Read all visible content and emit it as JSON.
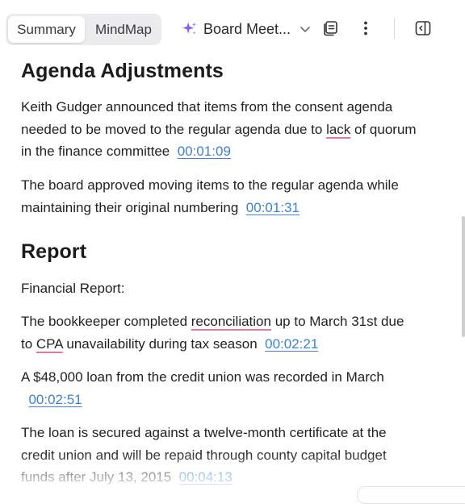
{
  "toolbar": {
    "tabs": [
      {
        "label": "Summary",
        "active": true
      },
      {
        "label": "MindMap",
        "active": false
      }
    ],
    "document_title": "Board Meet...",
    "icons": [
      "sparkle-icon",
      "chevron-down-icon",
      "notes-icon",
      "more-vertical-icon",
      "sidebar-toggle-icon"
    ]
  },
  "sections": [
    {
      "heading": "Agenda Adjustments",
      "paragraphs": [
        {
          "parts": [
            "Keith Gudger announced that items from the consent agenda needed to be moved to the regular agenda due to ",
            "lack",
            " of quorum in the finance committee"
          ],
          "timestamp": "00:01:09"
        },
        {
          "text": "The board approved moving items to the regular agenda while maintaining their original numbering",
          "timestamp": "00:01:31"
        }
      ]
    },
    {
      "heading": "Report",
      "paragraphs": [
        {
          "text": "Financial Report:"
        },
        {
          "parts": [
            "The bookkeeper completed ",
            "reconciliation",
            " up to March 31st due to ",
            "CPA",
            " unavailability during tax season"
          ],
          "timestamp": "00:02:21"
        },
        {
          "text": "A $48,000 loan from the credit union was recorded in March",
          "timestamp": "00:02:51"
        },
        {
          "text": "The loan is secured against a twelve-month certificate at the credit union and will be repaid through county capital budget funds after July 13, 2015",
          "timestamp": "00:04:13"
        }
      ]
    }
  ],
  "colors": {
    "link": "#3b82d6",
    "spellcheck": "#e8789b",
    "sparkle": "#8b5cf6"
  }
}
